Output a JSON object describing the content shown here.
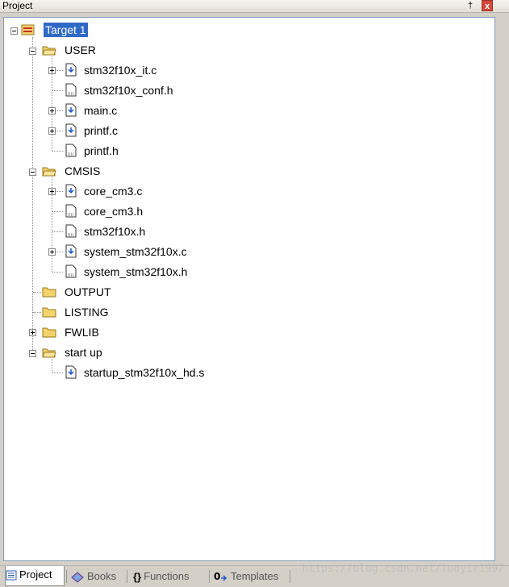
{
  "panel": {
    "title": "Project",
    "pin_glyph": "†",
    "close_glyph": "x"
  },
  "tree": {
    "target": "Target 1",
    "groups": [
      {
        "name": "USER",
        "files": [
          "stm32f10x_it.c",
          "stm32f10x_conf.h",
          "main.c",
          "printf.c",
          "printf.h"
        ]
      },
      {
        "name": "CMSIS",
        "files": [
          "core_cm3.c",
          "core_cm3.h",
          "stm32f10x.h",
          "system_stm32f10x.c",
          "system_stm32f10x.h"
        ]
      },
      {
        "name": "OUTPUT",
        "files": []
      },
      {
        "name": "LISTING",
        "files": []
      },
      {
        "name": "FWLIB",
        "files": []
      },
      {
        "name": "start up",
        "files": [
          "startup_stm32f10x_hd.s"
        ]
      }
    ]
  },
  "tabs": [
    {
      "label": "Project",
      "icon": "project-icon",
      "active": true
    },
    {
      "label": "Books",
      "icon": "books-icon",
      "active": false
    },
    {
      "label": "Functions",
      "icon": "functions-icon",
      "active": false
    },
    {
      "label": "Templates",
      "icon": "templates-icon",
      "active": false
    }
  ],
  "watermark": "https://blog.csdn.net/luoyir1997",
  "colors": {
    "selection": "#2f69c8",
    "folder": "#f3d36c",
    "tree_line": "#8a8a8a"
  }
}
